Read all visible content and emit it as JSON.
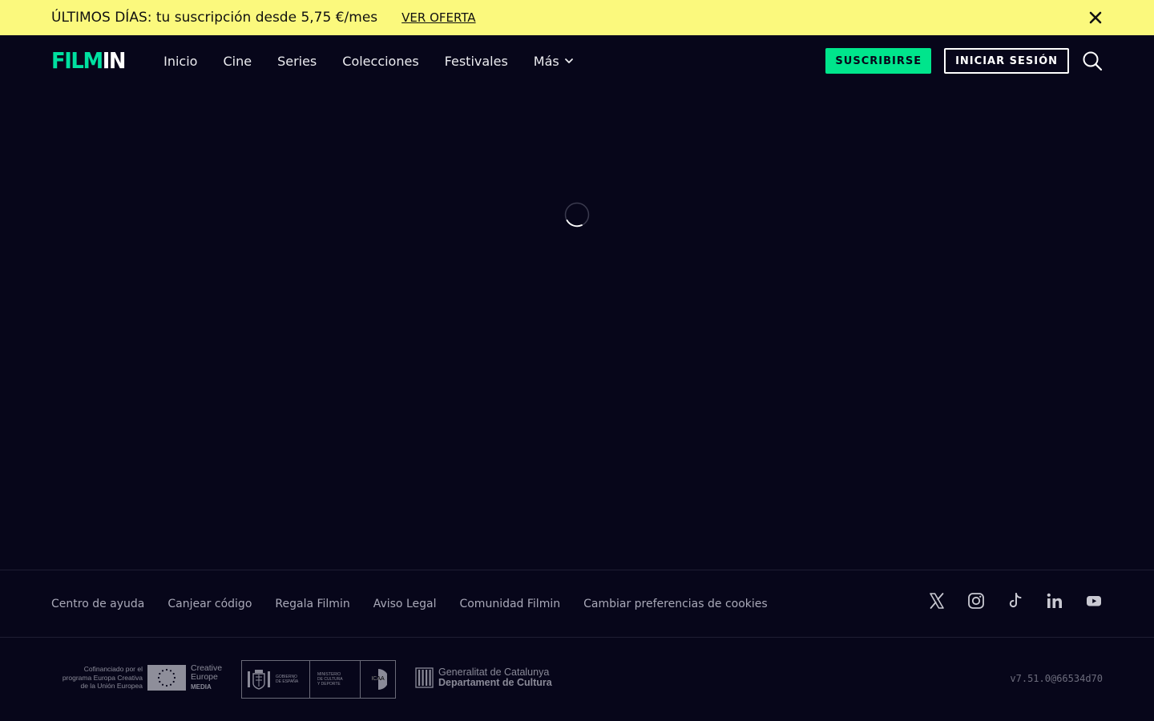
{
  "promo": {
    "text": "ÚLTIMOS DÍAS: tu suscripción desde 5,75 €/mes",
    "link": "VER OFERTA",
    "close_icon": "close-icon",
    "background": "#fbf97d"
  },
  "header": {
    "logo_part1": "FILM",
    "logo_part2": "IN",
    "logo_color": "#00e0a0",
    "nav": [
      {
        "label": "Inicio"
      },
      {
        "label": "Cine"
      },
      {
        "label": "Series"
      },
      {
        "label": "Colecciones"
      },
      {
        "label": "Festivales"
      },
      {
        "label": "Más",
        "icon": "chevron-down-icon"
      }
    ],
    "subscribe": "SUSCRIBIRSE",
    "login": "INICIAR SESIÓN",
    "search_icon": "search-icon",
    "accent": "#00e58c"
  },
  "main": {
    "loading_icon": "spinner-icon"
  },
  "footer": {
    "links": [
      {
        "label": "Centro de ayuda"
      },
      {
        "label": "Canjear código"
      },
      {
        "label": "Regala Filmin"
      },
      {
        "label": "Aviso Legal"
      },
      {
        "label": "Comunidad Filmin"
      },
      {
        "label": "Cambiar preferencias de cookies"
      }
    ],
    "socials": [
      {
        "icon": "x-twitter-icon"
      },
      {
        "icon": "instagram-icon"
      },
      {
        "icon": "tiktok-icon"
      },
      {
        "icon": "linkedin-icon"
      },
      {
        "icon": "youtube-icon"
      }
    ],
    "eu": {
      "line1": "Cofinanciado por el",
      "line2": "programa Europa Creativa",
      "line3": "de la Unión Europea",
      "ce1": "Creative",
      "ce2": "Europe",
      "ce3": "MEDIA"
    },
    "gov": {
      "cell1_l1": "GOBIERNO",
      "cell1_l2": "DE ESPAÑA",
      "cell2_l1": "MINISTERIO",
      "cell2_l2": "DE CULTURA",
      "cell2_l3": "Y DEPORTE",
      "cell3": "ICAA"
    },
    "gencat": {
      "line1": "Generalitat de Catalunya",
      "line2": "Departament de Cultura"
    },
    "version": "v7.51.0@66534d70",
    "background": "#07061a"
  }
}
